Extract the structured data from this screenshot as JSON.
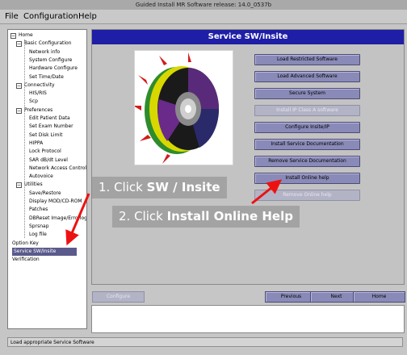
{
  "window": {
    "title": "Guided Install  MR Software release: 14.0_0537b"
  },
  "menu": [
    "File",
    "Configuration",
    "Help"
  ],
  "tree": [
    {
      "label": "Home",
      "level": 0,
      "expander": "−",
      "selected": false
    },
    {
      "label": "Basic Configuration",
      "level": 1,
      "expander": "−",
      "selected": false
    },
    {
      "label": "Network info",
      "level": 2,
      "expander": "",
      "selected": false
    },
    {
      "label": "System Configure",
      "level": 2,
      "expander": "",
      "selected": false
    },
    {
      "label": "Hardware Configure",
      "level": 2,
      "expander": "",
      "selected": false
    },
    {
      "label": "Set Time/Date",
      "level": 2,
      "expander": "",
      "selected": false
    },
    {
      "label": "Connectivity",
      "level": 1,
      "expander": "−",
      "selected": false
    },
    {
      "label": "HIS/RIS",
      "level": 2,
      "expander": "",
      "selected": false
    },
    {
      "label": "Scp",
      "level": 2,
      "expander": "",
      "selected": false
    },
    {
      "label": "Preferences",
      "level": 1,
      "expander": "−",
      "selected": false
    },
    {
      "label": "Edit Patient Data",
      "level": 2,
      "expander": "",
      "selected": false
    },
    {
      "label": "Set Exam Number",
      "level": 2,
      "expander": "",
      "selected": false
    },
    {
      "label": "Set Disk Limit",
      "level": 2,
      "expander": "",
      "selected": false
    },
    {
      "label": "HIPPA",
      "level": 2,
      "expander": "",
      "selected": false
    },
    {
      "label": "Lock Protocol",
      "level": 2,
      "expander": "",
      "selected": false
    },
    {
      "label": "SAR dB/dt Level",
      "level": 2,
      "expander": "",
      "selected": false
    },
    {
      "label": "Network Access Control",
      "level": 2,
      "expander": "",
      "selected": false
    },
    {
      "label": "Autovoice",
      "level": 2,
      "expander": "",
      "selected": false
    },
    {
      "label": "Utilities",
      "level": 1,
      "expander": "−",
      "selected": false
    },
    {
      "label": "Save/Restore",
      "level": 2,
      "expander": "",
      "selected": false
    },
    {
      "label": "Display MOD/CD-ROM",
      "level": 2,
      "expander": "",
      "selected": false
    },
    {
      "label": "Patches",
      "level": 2,
      "expander": "",
      "selected": false
    },
    {
      "label": "DBReset Image/Errorlog",
      "level": 2,
      "expander": "",
      "selected": false
    },
    {
      "label": "Sprsnap",
      "level": 2,
      "expander": "",
      "selected": false
    },
    {
      "label": "Log file",
      "level": 2,
      "expander": "",
      "selected": false
    },
    {
      "label": "Option Key",
      "level": 0,
      "expander": "",
      "selected": false
    },
    {
      "label": "Service SW/Insite",
      "level": 0,
      "expander": "",
      "selected": true
    },
    {
      "label": "Verification",
      "level": 0,
      "expander": "",
      "selected": false
    }
  ],
  "panel": {
    "title": "Service SW/Insite"
  },
  "service_buttons": [
    {
      "label": "Load Restricted Software",
      "enabled": true
    },
    {
      "label": "Load Advanced Software",
      "enabled": true
    },
    {
      "label": "Secure System",
      "enabled": true
    },
    {
      "label": "Install IP Class A software",
      "enabled": false
    },
    {
      "label": "Configure Insite/IP",
      "enabled": true
    },
    {
      "label": "Install Service Documentation",
      "enabled": true
    },
    {
      "label": "Remove Service Documentation",
      "enabled": true
    },
    {
      "label": "Install Online help",
      "enabled": true
    },
    {
      "label": "Remove Online help",
      "enabled": false
    }
  ],
  "nav": {
    "configure": "Configure",
    "previous": "Previous",
    "next": "Next",
    "home": "Home"
  },
  "status": "Load appropriate Service Software",
  "callouts": {
    "step1_prefix": "1. Click ",
    "step1_bold": "SW / Insite",
    "step2_prefix": "2. Click ",
    "step2_bold": "Install Online Help"
  },
  "colors": {
    "panel_title_bg": "#1e1ea6",
    "button_bg": "#8a8ab8",
    "selection_bg": "#5a5a8c",
    "arrow": "#ee1111"
  }
}
